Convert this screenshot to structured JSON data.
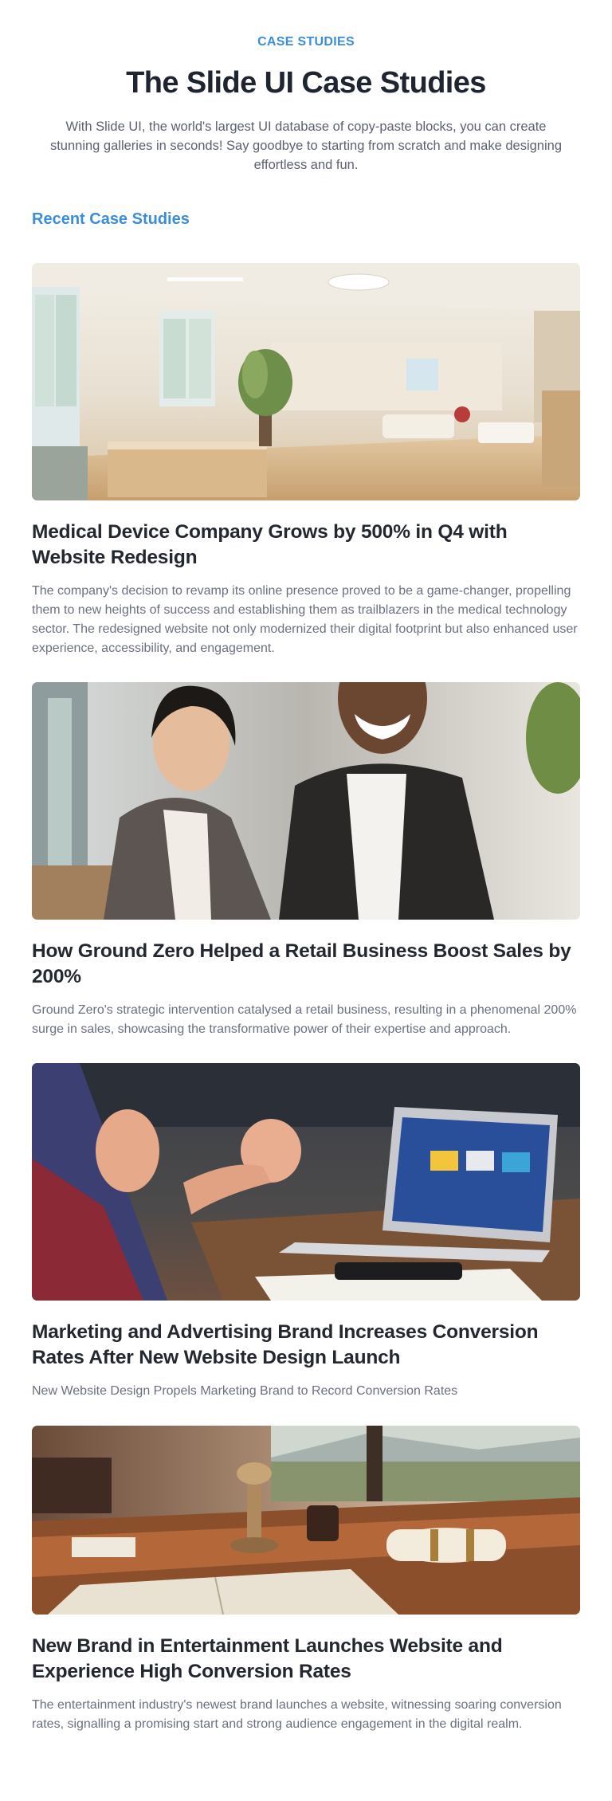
{
  "header": {
    "eyebrow": "CASE STUDIES",
    "title": "The Slide UI Case Studies",
    "lead": "With Slide UI, the world's largest UI database of copy-paste blocks, you can create stunning galleries in seconds! Say goodbye to starting from scratch and make designing effortless and fun."
  },
  "section": {
    "heading": "Recent Case Studies"
  },
  "cards": [
    {
      "title": "Medical Device Company Grows by 500% in Q4 with Website Redesign",
      "text": "The company's decision to revamp its online presence proved to be a game-changer, propelling them to new heights of success and establishing them as trailblazers in the medical technology sector. The redesigned website not only modernized their digital footprint but also enhanced user experience, accessibility, and engagement.",
      "image_icon": "office-interior-photo"
    },
    {
      "title": "How Ground Zero Helped a Retail Business Boost Sales by 200%",
      "text": "Ground Zero's strategic intervention catalysed a retail business, resulting in a phenomenal 200% surge in sales, showcasing the transformative power of their expertise and approach.",
      "image_icon": "business-people-photo"
    },
    {
      "title": "Marketing and Advertising Brand Increases Conversion Rates After New Website Design Launch",
      "text": "New Website Design Propels Marketing Brand to Record Conversion Rates",
      "image_icon": "laptop-meeting-photo"
    },
    {
      "title": "New Brand in Entertainment Launches Website and Experience High Conversion Rates",
      "text": "The entertainment industry's newest brand launches a website, witnessing soaring conversion rates, signalling a promising start and strong audience engagement in the digital realm.",
      "image_icon": "desk-scroll-photo"
    }
  ]
}
